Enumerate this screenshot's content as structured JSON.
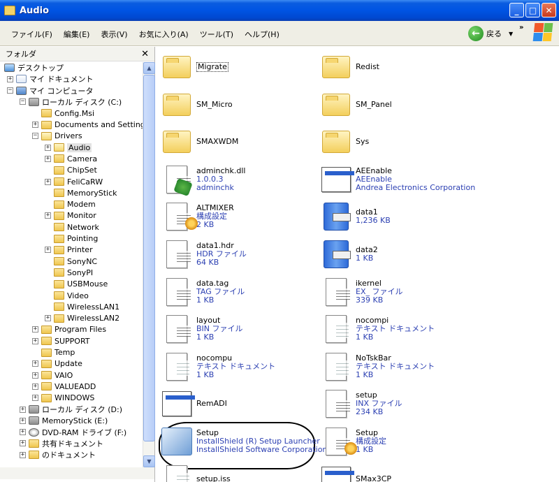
{
  "window": {
    "title": "Audio",
    "min_label": "_",
    "max_label": "□",
    "close_label": "✕"
  },
  "menu": {
    "items": [
      "ファイル(F)",
      "編集(E)",
      "表示(V)",
      "お気に入り(A)",
      "ツール(T)",
      "ヘルプ(H)"
    ],
    "back_label": "戻る",
    "back_arrow": "←",
    "back_dropdown": "▼",
    "more": "»"
  },
  "folder_pane": {
    "title": "フォルダ",
    "close_label": "✕",
    "tree": [
      {
        "label": "デスクトップ",
        "level": 0,
        "exp": "",
        "icon": "desk"
      },
      {
        "label": "マイ ドキュメント",
        "level": 1,
        "exp": "+",
        "icon": "doc"
      },
      {
        "label": "マイ コンピュータ",
        "level": 1,
        "exp": "−",
        "icon": "pc"
      },
      {
        "label": "ローカル ディスク (C:)",
        "level": 2,
        "exp": "−",
        "icon": "disk"
      },
      {
        "label": "Config.Msi",
        "level": 3,
        "exp": "",
        "icon": "folder"
      },
      {
        "label": "Documents and Settings",
        "level": 3,
        "exp": "+",
        "icon": "folder"
      },
      {
        "label": "Drivers",
        "level": 3,
        "exp": "−",
        "icon": "folder-open"
      },
      {
        "label": "Audio",
        "level": 4,
        "exp": "+",
        "icon": "folder-open",
        "selected": true
      },
      {
        "label": "Camera",
        "level": 4,
        "exp": "+",
        "icon": "folder"
      },
      {
        "label": "ChipSet",
        "level": 4,
        "exp": "",
        "icon": "folder"
      },
      {
        "label": "FeliCaRW",
        "level": 4,
        "exp": "+",
        "icon": "folder"
      },
      {
        "label": "MemoryStick",
        "level": 4,
        "exp": "",
        "icon": "folder"
      },
      {
        "label": "Modem",
        "level": 4,
        "exp": "",
        "icon": "folder"
      },
      {
        "label": "Monitor",
        "level": 4,
        "exp": "+",
        "icon": "folder"
      },
      {
        "label": "Network",
        "level": 4,
        "exp": "",
        "icon": "folder"
      },
      {
        "label": "Pointing",
        "level": 4,
        "exp": "",
        "icon": "folder"
      },
      {
        "label": "Printer",
        "level": 4,
        "exp": "+",
        "icon": "folder"
      },
      {
        "label": "SonyNC",
        "level": 4,
        "exp": "",
        "icon": "folder"
      },
      {
        "label": "SonyPI",
        "level": 4,
        "exp": "",
        "icon": "folder"
      },
      {
        "label": "USBMouse",
        "level": 4,
        "exp": "",
        "icon": "folder"
      },
      {
        "label": "Video",
        "level": 4,
        "exp": "",
        "icon": "folder"
      },
      {
        "label": "WirelessLAN1",
        "level": 4,
        "exp": "",
        "icon": "folder"
      },
      {
        "label": "WirelessLAN2",
        "level": 4,
        "exp": "+",
        "icon": "folder"
      },
      {
        "label": "Program Files",
        "level": 3,
        "exp": "+",
        "icon": "folder"
      },
      {
        "label": "SUPPORT",
        "level": 3,
        "exp": "+",
        "icon": "folder"
      },
      {
        "label": "Temp",
        "level": 3,
        "exp": "",
        "icon": "folder"
      },
      {
        "label": "Update",
        "level": 3,
        "exp": "+",
        "icon": "folder"
      },
      {
        "label": "VAIO",
        "level": 3,
        "exp": "+",
        "icon": "folder"
      },
      {
        "label": "VALUEADD",
        "level": 3,
        "exp": "+",
        "icon": "folder"
      },
      {
        "label": "WINDOWS",
        "level": 3,
        "exp": "+",
        "icon": "folder"
      },
      {
        "label": "ローカル ディスク (D:)",
        "level": 2,
        "exp": "+",
        "icon": "disk"
      },
      {
        "label": "MemoryStick (E:)",
        "level": 2,
        "exp": "+",
        "icon": "disk"
      },
      {
        "label": "DVD-RAM ドライブ (F:)",
        "level": 2,
        "exp": "+",
        "icon": "cd"
      },
      {
        "label": "共有ドキュメント",
        "level": 2,
        "exp": "+",
        "icon": "folder"
      },
      {
        "label": "のドキュメント",
        "level": 2,
        "exp": "+",
        "icon": "folder"
      }
    ],
    "scroll_up": "▲",
    "scroll_down": "▼"
  },
  "files": [
    {
      "name": "Migrate",
      "lines": [],
      "icon": "folder",
      "selected": true
    },
    {
      "name": "Redist",
      "lines": [],
      "icon": "folder"
    },
    {
      "name": "SM_Micro",
      "lines": [],
      "icon": "folder"
    },
    {
      "name": "SM_Panel",
      "lines": [],
      "icon": "folder"
    },
    {
      "name": "SMAXWDM",
      "lines": [],
      "icon": "folder"
    },
    {
      "name": "Sys",
      "lines": [],
      "icon": "folder"
    },
    {
      "name": "adminchk.dll",
      "lines": [
        "1.0.0.3",
        "adminchk"
      ],
      "icon": "dll"
    },
    {
      "name": "AEEnable",
      "lines": [
        "AEEnable",
        "Andrea Electronics Corporation"
      ],
      "icon": "app"
    },
    {
      "name": "ALTMIXER",
      "lines": [
        "構成設定",
        "2 KB"
      ],
      "icon": "config"
    },
    {
      "name": "data1",
      "lines": [
        "1,236 KB"
      ],
      "icon": "cab"
    },
    {
      "name": "data1.hdr",
      "lines": [
        "HDR ファイル",
        "64 KB"
      ],
      "icon": "file"
    },
    {
      "name": "data2",
      "lines": [
        "1 KB"
      ],
      "icon": "cab"
    },
    {
      "name": "data.tag",
      "lines": [
        "TAG ファイル",
        "1 KB"
      ],
      "icon": "file"
    },
    {
      "name": "ikernel",
      "lines": [
        "EX_ ファイル",
        "339 KB"
      ],
      "icon": "file"
    },
    {
      "name": "layout",
      "lines": [
        "BIN ファイル",
        "1 KB"
      ],
      "icon": "file"
    },
    {
      "name": "nocompi",
      "lines": [
        "テキスト ドキュメント",
        "1 KB"
      ],
      "icon": "text"
    },
    {
      "name": "nocompu",
      "lines": [
        "テキスト ドキュメント",
        "1 KB"
      ],
      "icon": "text"
    },
    {
      "name": "NoTskBar",
      "lines": [
        "テキスト ドキュメント",
        "1 KB"
      ],
      "icon": "text"
    },
    {
      "name": "RemADI",
      "lines": [],
      "icon": "app"
    },
    {
      "name": "setup",
      "lines": [
        "INX ファイル",
        "234 KB"
      ],
      "icon": "file"
    },
    {
      "name": "Setup",
      "lines": [
        "InstallShield (R) Setup Launcher",
        "InstallShield Software Corporation"
      ],
      "icon": "setup"
    },
    {
      "name": "Setup",
      "lines": [
        "構成設定",
        "1 KB"
      ],
      "icon": "config"
    },
    {
      "name": "setup.iss",
      "lines": [],
      "icon": "text"
    },
    {
      "name": "SMax3CP",
      "lines": [],
      "icon": "app"
    }
  ]
}
